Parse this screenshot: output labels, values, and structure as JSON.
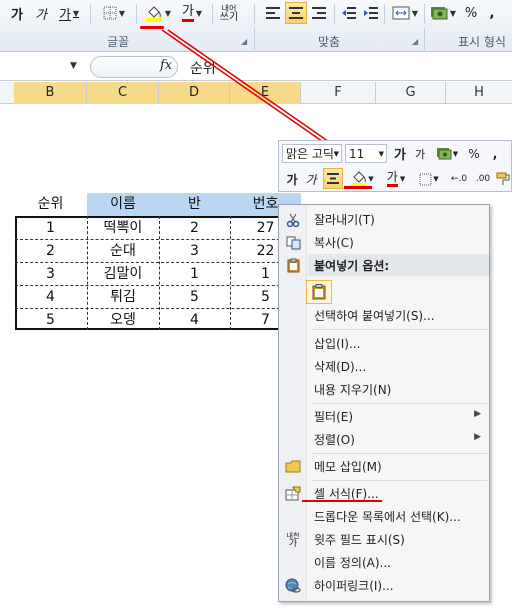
{
  "ribbon": {
    "font_group_label": "글꼴",
    "alignment_group_label": "맞춤",
    "number_group_label": "표시 형식",
    "bold_label": "가",
    "italic_label": "가",
    "underline_label": "가",
    "font_color_label": "가",
    "wrap_label_top": "내어",
    "wrap_label_bottom": "쓰기",
    "percent_label": "%",
    "comma_label": ","
  },
  "formula_bar": {
    "fx_label": "fx",
    "value": "순위"
  },
  "columns": [
    "B",
    "C",
    "D",
    "E",
    "F",
    "G",
    "H"
  ],
  "table": {
    "headers": [
      "순위",
      "이름",
      "반",
      "번호"
    ],
    "rows": [
      [
        "1",
        "떡뽁이",
        "2",
        "27"
      ],
      [
        "2",
        "순대",
        "3",
        "22"
      ],
      [
        "3",
        "김말이",
        "1",
        "1"
      ],
      [
        "4",
        "튀김",
        "5",
        "5"
      ],
      [
        "5",
        "오뎅",
        "4",
        "7"
      ]
    ]
  },
  "mini_toolbar": {
    "font_name": "맑은 고딕",
    "font_size": "11",
    "grow_label": "가",
    "shrink_label": "가",
    "percent_label": "%",
    "comma_label": ",",
    "bold_label": "가",
    "italic_label": "가",
    "font_color_label": "가",
    "decimal_inc": "←.0",
    "decimal_dec": ".00"
  },
  "context_menu": {
    "cut": "잘라내기(T)",
    "copy": "복사(C)",
    "paste_options": "붙여넣기 옵션:",
    "paste_special": "선택하여 붙여넣기(S)...",
    "insert": "삽입(I)...",
    "delete": "삭제(D)...",
    "clear": "내용 지우기(N)",
    "filter": "필터(E)",
    "sort": "정렬(O)",
    "insert_comment": "메모 삽입(M)",
    "format_cells": "셀 서식(F)...",
    "pick_from_list": "드롭다운 목록에서 선택(K)...",
    "phonetic": "윗주 필드 표시(S)",
    "define_name": "이름 정의(A)...",
    "hyperlink": "하이퍼링크(I)...",
    "phonetic_icon_top": "내천",
    "phonetic_icon_bottom": "가"
  },
  "colors": {
    "highlight_underline": "#e00000",
    "header_fill": "#b9d6f2",
    "selected_column": "#f7d98c"
  }
}
